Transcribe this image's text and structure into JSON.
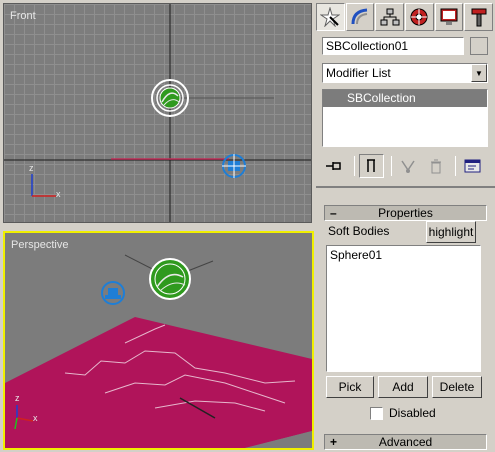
{
  "viewports": {
    "front": {
      "label": "Front",
      "axis_z": "z",
      "axis_x": "x"
    },
    "perspective": {
      "label": "Perspective",
      "axis_z": "z",
      "axis_x": "x"
    }
  },
  "command_panel": {
    "tabs": [
      {
        "name": "create",
        "icon": "create-star-icon",
        "active": true
      },
      {
        "name": "modify",
        "icon": "modify-arc-icon",
        "active": false
      },
      {
        "name": "hierarchy",
        "icon": "hierarchy-icon",
        "active": false
      },
      {
        "name": "motion",
        "icon": "motion-wheel-icon",
        "active": false
      },
      {
        "name": "display",
        "icon": "display-monitor-icon",
        "active": false
      },
      {
        "name": "utilities",
        "icon": "utilities-hammer-icon",
        "active": false
      }
    ],
    "object_name": "SBCollection01",
    "modifier_list": "Modifier List",
    "stack_items": [
      "SBCollection"
    ],
    "stack_tools": [
      "pin-stack-icon",
      "show-end-result-icon",
      "make-unique-icon",
      "remove-modifier-icon",
      "configure-sets-icon"
    ]
  },
  "properties": {
    "rollout_title": "Properties",
    "rollout_sign": "–",
    "soft_bodies_label": "Soft Bodies",
    "highlight_button": "highlight",
    "list_items": [
      "Sphere01"
    ],
    "pick_button": "Pick",
    "add_button": "Add",
    "delete_button": "Delete",
    "disabled_label": "Disabled",
    "disabled_checked": false
  },
  "advanced": {
    "rollout_title": "Advanced",
    "rollout_sign": "+"
  },
  "colors": {
    "viewport_bg": "#7d7d7d",
    "grid_line": "#8f8f8f",
    "active_border": "#f0f000",
    "plane": "#b0145a",
    "helper_blue": "#1e7ed6",
    "sphere_green": "#2f9a1e"
  }
}
